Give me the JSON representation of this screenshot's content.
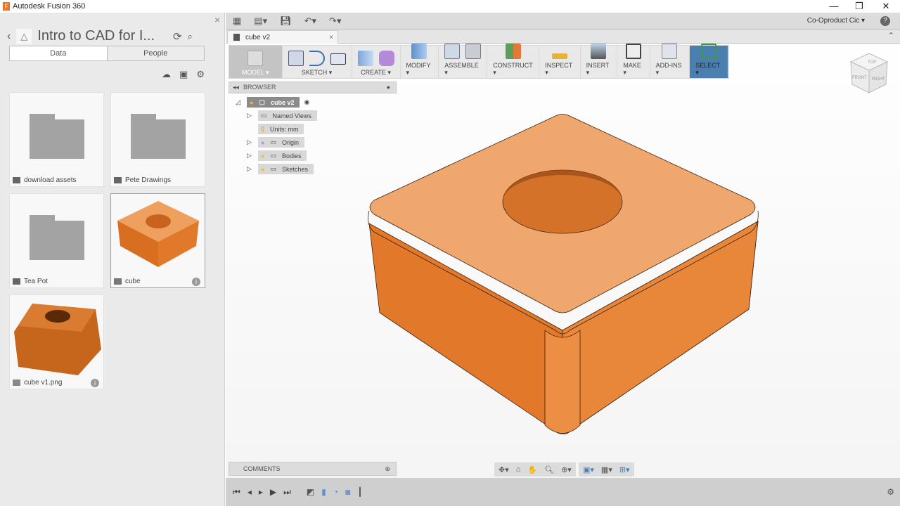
{
  "window": {
    "title": "Autodesk Fusion 360",
    "minimize": "—",
    "restore": "❐",
    "close": "✕"
  },
  "data_panel": {
    "project_title": "Intro to CAD for I...",
    "tabs": [
      "Data",
      "People"
    ],
    "close": "×",
    "items": [
      {
        "name": "download assets",
        "type": "folder"
      },
      {
        "name": "Pete Drawings",
        "type": "folder"
      },
      {
        "name": "Tea Pot",
        "type": "folder"
      },
      {
        "name": "cube",
        "type": "design",
        "selected": true
      },
      {
        "name": "cube v1.png",
        "type": "image"
      }
    ]
  },
  "app_toolbar": {
    "user": "Co-Oproduct Cic ▾",
    "help": "?"
  },
  "document_tab": {
    "name": "cube v2",
    "close": "×"
  },
  "ribbon": {
    "groups": [
      "MODEL ▾",
      "SKETCH ▾",
      "CREATE ▾",
      "MODIFY ▾",
      "ASSEMBLE ▾",
      "CONSTRUCT ▾",
      "INSPECT ▾",
      "INSERT ▾",
      "MAKE ▾",
      "ADD-INS ▾",
      "SELECT ▾"
    ]
  },
  "browser": {
    "title": "BROWSER",
    "root": "cube v2",
    "nodes": [
      "Named Views",
      "Units: mm",
      "Origin",
      "Bodies",
      "Sketches"
    ]
  },
  "comments": {
    "title": "COMMENTS"
  },
  "viewcube": {
    "top": "TOP",
    "front": "FRONT",
    "right": "RIGHT"
  },
  "colors": {
    "body": "#e8843a",
    "top_face": "#f0a76d",
    "select": "#4b7fb0"
  }
}
